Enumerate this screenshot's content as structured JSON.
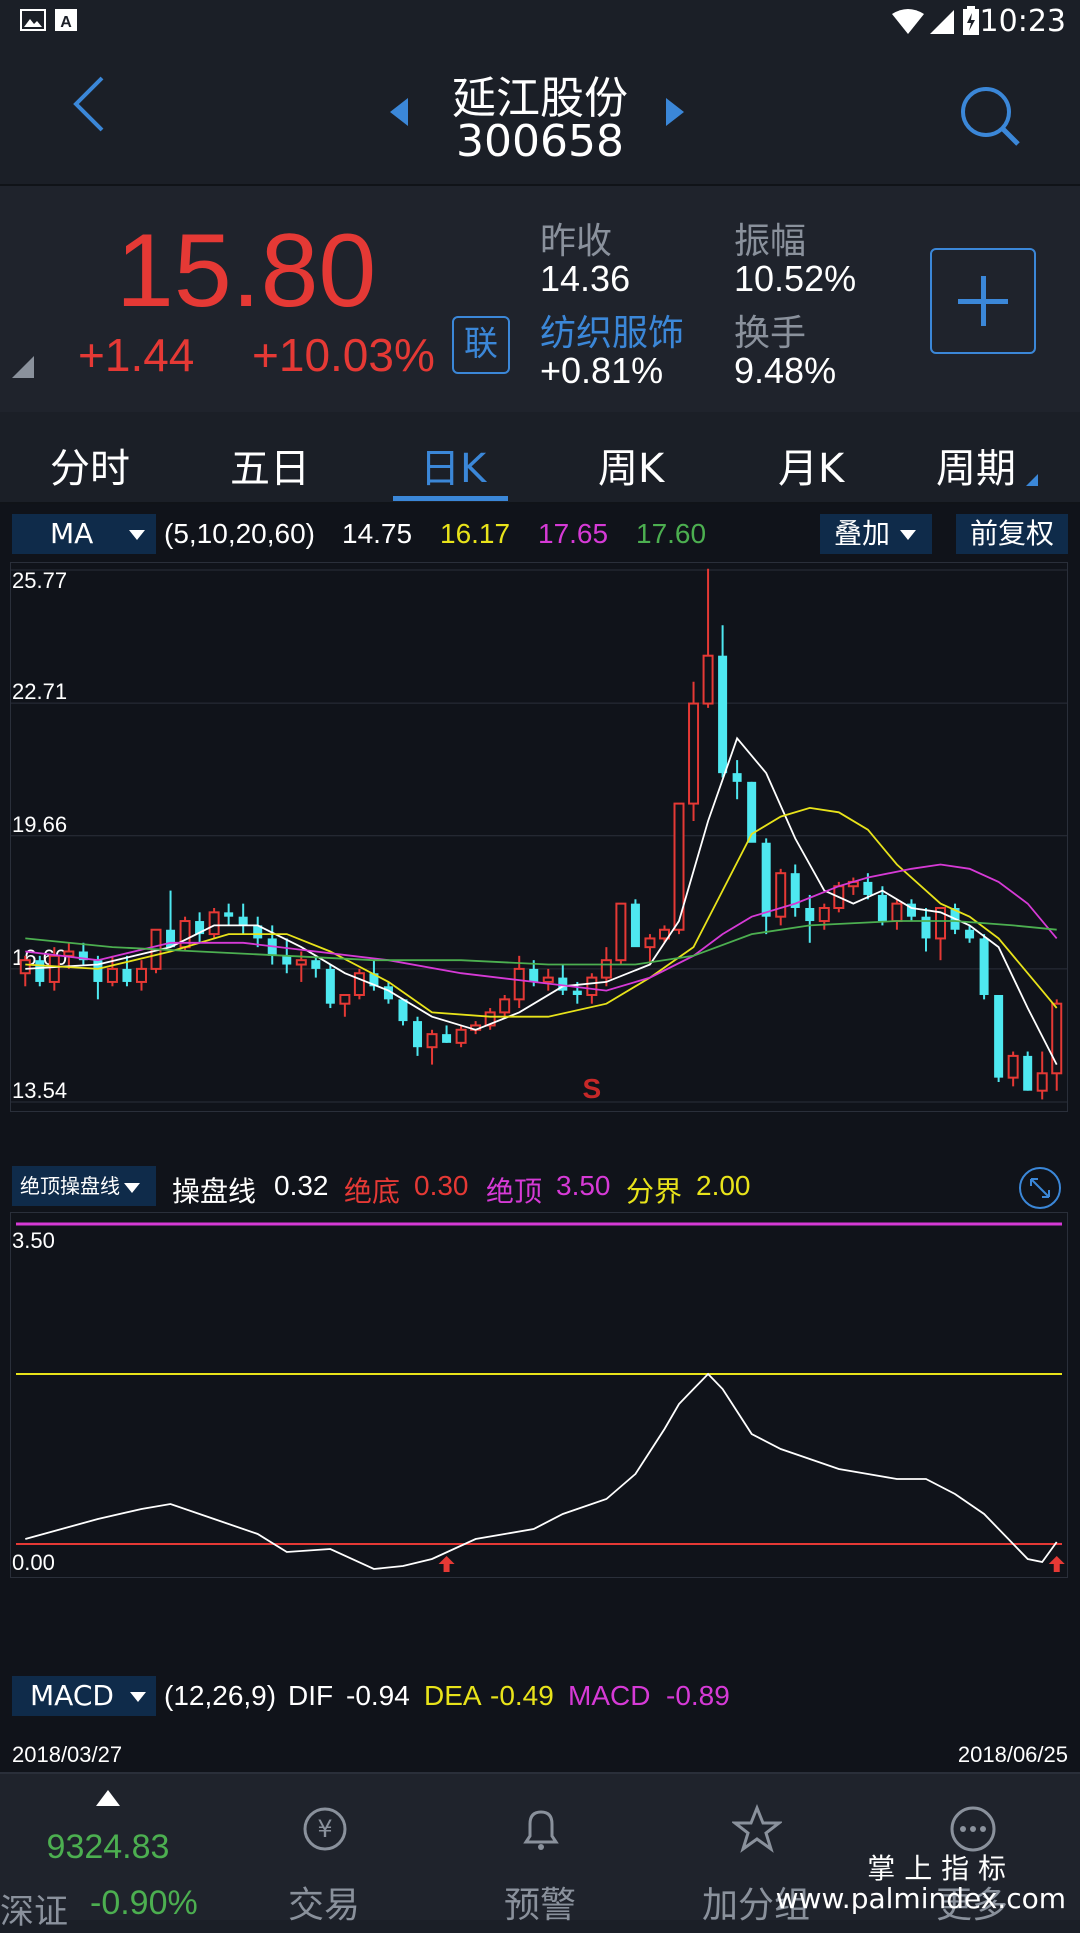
{
  "status": {
    "time": "10:23"
  },
  "header": {
    "name": "延江股份",
    "code": "300658"
  },
  "quote": {
    "price": "15.80",
    "change": "+1.44",
    "change_pct": "+10.03%",
    "lian": "联",
    "prev_close_label": "昨收",
    "prev_close": "14.36",
    "amplitude_label": "振幅",
    "amplitude": "10.52%",
    "sector": "纺织服饰",
    "sector_pct": "+0.81%",
    "turnover_label": "换手",
    "turnover": "9.48%"
  },
  "tabs": [
    "分时",
    "五日",
    "日K",
    "周K",
    "月K",
    "周期"
  ],
  "active_tab": 2,
  "ma_legend": {
    "select": "MA",
    "params": "(5,10,20,60)",
    "v5": "14.75",
    "v10": "16.17",
    "v20": "17.65",
    "v60": "17.60",
    "overlay": "叠加",
    "fq": "前复权"
  },
  "indicator_legend": {
    "select": "绝顶操盘线",
    "line_label": "操盘线",
    "line_val": "0.32",
    "bottom_label": "绝底",
    "bottom_val": "0.30",
    "top_label": "绝顶",
    "top_val": "3.50",
    "bound_label": "分界",
    "bound_val": "2.00"
  },
  "macd_legend": {
    "select": "MACD",
    "params": "(12,26,9)",
    "dif_label": "DIF",
    "dif": "-0.94",
    "dea_label": "DEA",
    "dea": "-0.49",
    "macd_label": "MACD",
    "macd": "-0.89"
  },
  "dates": {
    "start": "2018/03/27",
    "end": "2018/06/25"
  },
  "colors": {
    "up": "#e53935",
    "down": "#4ee8f0",
    "ma5": "#ffffff",
    "ma10": "#e8e31a",
    "ma20": "#d63ad6",
    "ma60": "#4caf50",
    "accent": "#3b87d8"
  },
  "nav": {
    "index_value": "9324.83",
    "index_name": "深证",
    "index_pct": "-0.90%",
    "items": [
      "交易",
      "预警",
      "加分组",
      "更多"
    ],
    "watermark_top": "掌 上 指 标",
    "watermark_bottom": "www.palmindex.com"
  },
  "chart_data": [
    {
      "type": "candlestick",
      "ylim": [
        13.54,
        25.77
      ],
      "yticks": [
        "25.77",
        "22.71",
        "19.66",
        "16.60",
        "13.54"
      ],
      "signal": "S",
      "candles": [
        [
          16.5,
          16.9,
          16.2,
          16.8
        ],
        [
          16.8,
          16.9,
          16.2,
          16.3
        ],
        [
          16.3,
          17.1,
          16.1,
          16.9
        ],
        [
          16.9,
          17.2,
          16.6,
          17.0
        ],
        [
          17.0,
          17.2,
          16.7,
          16.8
        ],
        [
          16.8,
          16.9,
          15.9,
          16.3
        ],
        [
          16.3,
          16.9,
          16.2,
          16.6
        ],
        [
          16.6,
          16.9,
          16.2,
          16.3
        ],
        [
          16.3,
          16.8,
          16.1,
          16.6
        ],
        [
          16.6,
          17.5,
          16.5,
          17.5
        ],
        [
          17.5,
          18.4,
          17.2,
          17.1
        ],
        [
          17.1,
          17.8,
          17.0,
          17.7
        ],
        [
          17.7,
          17.9,
          17.2,
          17.4
        ],
        [
          17.4,
          18.0,
          17.3,
          17.9
        ],
        [
          17.9,
          18.1,
          17.6,
          17.8
        ],
        [
          17.8,
          18.1,
          17.4,
          17.6
        ],
        [
          17.6,
          17.8,
          17.1,
          17.3
        ],
        [
          17.3,
          17.6,
          16.7,
          16.9
        ],
        [
          16.9,
          17.3,
          16.5,
          16.7
        ],
        [
          16.7,
          17.0,
          16.3,
          16.8
        ],
        [
          16.8,
          16.9,
          16.4,
          16.6
        ],
        [
          16.6,
          16.7,
          15.7,
          15.8
        ],
        [
          15.8,
          16.0,
          15.5,
          16.0
        ],
        [
          16.0,
          16.6,
          15.9,
          16.5
        ],
        [
          16.5,
          16.8,
          16.1,
          16.2
        ],
        [
          16.2,
          16.3,
          15.8,
          15.9
        ],
        [
          15.9,
          15.9,
          15.3,
          15.4
        ],
        [
          15.4,
          15.5,
          14.6,
          14.8
        ],
        [
          14.8,
          15.2,
          14.4,
          15.1
        ],
        [
          15.1,
          15.3,
          14.9,
          14.9
        ],
        [
          14.9,
          15.3,
          14.8,
          15.2
        ],
        [
          15.2,
          15.4,
          15.1,
          15.3
        ],
        [
          15.3,
          15.7,
          15.2,
          15.6
        ],
        [
          15.6,
          16.0,
          15.5,
          15.9
        ],
        [
          15.9,
          16.9,
          15.7,
          16.6
        ],
        [
          16.6,
          16.8,
          16.2,
          16.3
        ],
        [
          16.3,
          16.6,
          16.1,
          16.4
        ],
        [
          16.4,
          16.7,
          16.0,
          16.1
        ],
        [
          16.1,
          16.3,
          15.8,
          16.0
        ],
        [
          16.0,
          16.5,
          15.8,
          16.4
        ],
        [
          16.4,
          17.1,
          16.2,
          16.8
        ],
        [
          16.8,
          18.1,
          16.7,
          18.1
        ],
        [
          18.1,
          18.2,
          17.2,
          17.1
        ],
        [
          17.1,
          17.4,
          16.7,
          17.3
        ],
        [
          17.3,
          17.6,
          17.2,
          17.5
        ],
        [
          17.5,
          20.4,
          17.4,
          20.4
        ],
        [
          20.4,
          23.2,
          20.0,
          22.7
        ],
        [
          22.7,
          25.8,
          22.6,
          23.8
        ],
        [
          23.8,
          24.5,
          21.0,
          21.1
        ],
        [
          21.1,
          21.4,
          20.5,
          20.9
        ],
        [
          20.9,
          20.9,
          19.6,
          19.5
        ],
        [
          19.5,
          19.6,
          17.4,
          17.8
        ],
        [
          17.8,
          18.9,
          17.6,
          18.8
        ],
        [
          18.8,
          19.0,
          17.8,
          18.0
        ],
        [
          18.0,
          18.3,
          17.2,
          17.7
        ],
        [
          17.7,
          18.1,
          17.5,
          18.0
        ],
        [
          18.0,
          18.6,
          17.9,
          18.5
        ],
        [
          18.5,
          18.7,
          18.3,
          18.6
        ],
        [
          18.6,
          18.8,
          18.2,
          18.3
        ],
        [
          18.3,
          18.5,
          17.6,
          17.7
        ],
        [
          17.7,
          18.2,
          17.5,
          18.1
        ],
        [
          18.1,
          18.2,
          17.7,
          17.8
        ],
        [
          17.8,
          18.0,
          17.0,
          17.3
        ],
        [
          17.3,
          18.0,
          16.8,
          18.0
        ],
        [
          18.0,
          18.1,
          17.4,
          17.5
        ],
        [
          17.5,
          17.6,
          17.2,
          17.3
        ],
        [
          17.3,
          17.4,
          15.9,
          16.0
        ],
        [
          16.0,
          16.0,
          14.0,
          14.1
        ],
        [
          14.1,
          14.7,
          13.9,
          14.6
        ],
        [
          14.6,
          14.7,
          13.8,
          13.8
        ],
        [
          13.8,
          14.7,
          13.6,
          14.2
        ],
        [
          14.2,
          15.9,
          13.8,
          15.8
        ]
      ],
      "ma_series": [
        {
          "name": "MA5",
          "points": [
            [
              0,
              16.6
            ],
            [
              5,
              16.7
            ],
            [
              10,
              17.1
            ],
            [
              13,
              17.6
            ],
            [
              16,
              17.6
            ],
            [
              19,
              17.1
            ],
            [
              22,
              16.5
            ],
            [
              25,
              16.1
            ],
            [
              28,
              15.5
            ],
            [
              31,
              15.2
            ],
            [
              34,
              15.6
            ],
            [
              37,
              16.2
            ],
            [
              40,
              16.3
            ],
            [
              43,
              16.7
            ],
            [
              45,
              17.7
            ],
            [
              47,
              20.0
            ],
            [
              49,
              21.9
            ],
            [
              51,
              21.1
            ],
            [
              53,
              19.6
            ],
            [
              55,
              18.4
            ],
            [
              57,
              18.1
            ],
            [
              59,
              18.4
            ],
            [
              61,
              18.0
            ],
            [
              63,
              17.9
            ],
            [
              65,
              17.6
            ],
            [
              67,
              17.1
            ],
            [
              69,
              15.7
            ],
            [
              71,
              14.4
            ]
          ]
        },
        {
          "name": "MA10",
          "points": [
            [
              0,
              16.7
            ],
            [
              5,
              16.6
            ],
            [
              10,
              17.0
            ],
            [
              14,
              17.4
            ],
            [
              18,
              17.4
            ],
            [
              21,
              17.0
            ],
            [
              25,
              16.3
            ],
            [
              28,
              15.6
            ],
            [
              32,
              15.5
            ],
            [
              36,
              15.5
            ],
            [
              40,
              15.8
            ],
            [
              43,
              16.4
            ],
            [
              46,
              17.1
            ],
            [
              48,
              18.4
            ],
            [
              50,
              19.7
            ],
            [
              52,
              20.1
            ],
            [
              54,
              20.3
            ],
            [
              56,
              20.2
            ],
            [
              58,
              19.8
            ],
            [
              60,
              19.0
            ],
            [
              63,
              18.1
            ],
            [
              65,
              17.8
            ],
            [
              67,
              17.3
            ],
            [
              70,
              16.1
            ],
            [
              71,
              15.7
            ]
          ]
        },
        {
          "name": "MA20",
          "points": [
            [
              0,
              17.0
            ],
            [
              5,
              16.8
            ],
            [
              10,
              17.2
            ],
            [
              15,
              17.2
            ],
            [
              20,
              17.0
            ],
            [
              25,
              16.8
            ],
            [
              30,
              16.5
            ],
            [
              35,
              16.3
            ],
            [
              40,
              16.1
            ],
            [
              43,
              16.4
            ],
            [
              46,
              16.9
            ],
            [
              48,
              17.4
            ],
            [
              50,
              17.8
            ],
            [
              53,
              18.1
            ],
            [
              56,
              18.5
            ],
            [
              58,
              18.7
            ],
            [
              61,
              18.9
            ],
            [
              63,
              19.0
            ],
            [
              65,
              18.9
            ],
            [
              67,
              18.6
            ],
            [
              69,
              18.1
            ],
            [
              71,
              17.3
            ]
          ]
        },
        {
          "name": "MA60",
          "points": [
            [
              0,
              17.3
            ],
            [
              6,
              17.1
            ],
            [
              12,
              17.0
            ],
            [
              18,
              16.9
            ],
            [
              24,
              16.8
            ],
            [
              30,
              16.8
            ],
            [
              36,
              16.7
            ],
            [
              42,
              16.7
            ],
            [
              46,
              16.9
            ],
            [
              50,
              17.4
            ],
            [
              54,
              17.6
            ],
            [
              60,
              17.7
            ],
            [
              64,
              17.7
            ],
            [
              68,
              17.6
            ],
            [
              71,
              17.5
            ]
          ]
        }
      ]
    },
    {
      "type": "line",
      "ylim": [
        0.0,
        3.5
      ],
      "yticks": [
        "3.50",
        "0.00"
      ],
      "lines": [
        {
          "label": "绝顶",
          "value": 3.5
        },
        {
          "label": "分界",
          "value": 2.0
        },
        {
          "label": "绝底",
          "value": 0.3
        }
      ],
      "points": [
        [
          0,
          0.35
        ],
        [
          5,
          0.55
        ],
        [
          8,
          0.65
        ],
        [
          10,
          0.7
        ],
        [
          13,
          0.55
        ],
        [
          16,
          0.4
        ],
        [
          18,
          0.22
        ],
        [
          21,
          0.25
        ],
        [
          24,
          0.05
        ],
        [
          26,
          0.08
        ],
        [
          28,
          0.15
        ],
        [
          31,
          0.35
        ],
        [
          33,
          0.4
        ],
        [
          35,
          0.45
        ],
        [
          37,
          0.6
        ],
        [
          40,
          0.75
        ],
        [
          42,
          1.0
        ],
        [
          44,
          1.45
        ],
        [
          45,
          1.7
        ],
        [
          46,
          1.85
        ],
        [
          47,
          2.0
        ],
        [
          48,
          1.85
        ],
        [
          50,
          1.4
        ],
        [
          52,
          1.25
        ],
        [
          54,
          1.15
        ],
        [
          56,
          1.05
        ],
        [
          58,
          1.0
        ],
        [
          60,
          0.95
        ],
        [
          62,
          0.95
        ],
        [
          64,
          0.8
        ],
        [
          66,
          0.6
        ],
        [
          68,
          0.3
        ],
        [
          69,
          0.15
        ],
        [
          70,
          0.12
        ],
        [
          71,
          0.32
        ]
      ]
    }
  ]
}
